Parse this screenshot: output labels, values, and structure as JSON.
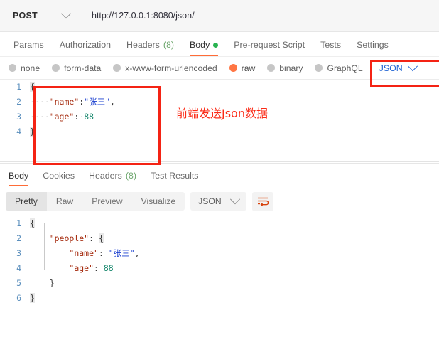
{
  "request_bar": {
    "method": "POST",
    "method_icon": "chevron-down-icon",
    "url": "http://127.0.0.1:8080/json/"
  },
  "request_tabs": [
    {
      "label": "Params",
      "active": false
    },
    {
      "label": "Authorization",
      "active": false
    },
    {
      "label": "Headers",
      "count": "(8)",
      "active": false
    },
    {
      "label": "Body",
      "active": true,
      "dot": "green-status-dot"
    },
    {
      "label": "Pre-request Script",
      "active": false
    },
    {
      "label": "Tests",
      "active": false
    },
    {
      "label": "Settings",
      "active": false
    }
  ],
  "body_types": [
    {
      "label": "none",
      "selected": false
    },
    {
      "label": "form-data",
      "selected": false
    },
    {
      "label": "x-www-form-urlencoded",
      "selected": false
    },
    {
      "label": "raw",
      "selected": true
    },
    {
      "label": "binary",
      "selected": false
    },
    {
      "label": "GraphQL",
      "selected": false
    }
  ],
  "body_format": {
    "label": "JSON",
    "icon": "chevron-down-icon"
  },
  "request_body": {
    "lines": [
      {
        "n": "1",
        "parts": [
          {
            "t": "{",
            "c": "p-brace"
          }
        ]
      },
      {
        "n": "2",
        "parts": [
          {
            "t": "····",
            "c": "p-ind"
          },
          {
            "t": "\"name\"",
            "c": "p-key"
          },
          {
            "t": ":",
            "c": "p-punct"
          },
          {
            "t": "\"张三\"",
            "c": "p-str"
          },
          {
            "t": ",",
            "c": "p-punct"
          }
        ]
      },
      {
        "n": "3",
        "parts": [
          {
            "t": "····",
            "c": "p-ind"
          },
          {
            "t": "\"age\"",
            "c": "p-key"
          },
          {
            "t": ":",
            "c": "p-punct"
          },
          {
            "t": "·",
            "c": "p-ind"
          },
          {
            "t": "88",
            "c": "p-num"
          }
        ]
      },
      {
        "n": "4",
        "parts": [
          {
            "t": "}",
            "c": "p-brace"
          }
        ]
      }
    ]
  },
  "annotations": {
    "note_text": "前端发送Json数据",
    "box_color": "#f42314"
  },
  "response_tabs": [
    {
      "label": "Body",
      "active": true
    },
    {
      "label": "Cookies",
      "active": false
    },
    {
      "label": "Headers",
      "count": "(8)",
      "active": false
    },
    {
      "label": "Test Results",
      "active": false
    }
  ],
  "response_toolbar": {
    "views": [
      {
        "label": "Pretty",
        "active": true
      },
      {
        "label": "Raw",
        "active": false
      },
      {
        "label": "Preview",
        "active": false
      },
      {
        "label": "Visualize",
        "active": false
      }
    ],
    "format": {
      "label": "JSON",
      "icon": "chevron-down-icon"
    },
    "wrap_button_icon": "wrap-text-icon"
  },
  "response_body": {
    "lines": [
      {
        "n": "1",
        "parts": [
          {
            "t": "{",
            "c": "p-brace"
          }
        ]
      },
      {
        "n": "2",
        "parts": [
          {
            "t": "    ",
            "c": "p-ind"
          },
          {
            "t": "\"people\"",
            "c": "p-key"
          },
          {
            "t": ": ",
            "c": "p-punct"
          },
          {
            "t": "{",
            "c": "p-brace"
          }
        ]
      },
      {
        "n": "3",
        "parts": [
          {
            "t": "        ",
            "c": "p-ind"
          },
          {
            "t": "\"name\"",
            "c": "p-key"
          },
          {
            "t": ": ",
            "c": "p-punct"
          },
          {
            "t": "\"张三\"",
            "c": "p-str"
          },
          {
            "t": ",",
            "c": "p-punct"
          }
        ]
      },
      {
        "n": "4",
        "parts": [
          {
            "t": "        ",
            "c": "p-ind"
          },
          {
            "t": "\"age\"",
            "c": "p-key"
          },
          {
            "t": ": ",
            "c": "p-punct"
          },
          {
            "t": "88",
            "c": "p-num"
          }
        ]
      },
      {
        "n": "5",
        "parts": [
          {
            "t": "    ",
            "c": "p-ind"
          },
          {
            "t": "}",
            "c": "p-punct"
          }
        ]
      },
      {
        "n": "6",
        "parts": [
          {
            "t": "}",
            "c": "p-brace"
          }
        ]
      }
    ]
  },
  "colors": {
    "accent_orange": "#ff6c37",
    "link_blue": "#2567d4",
    "status_green": "#29b351",
    "annotation_red": "#f42314"
  }
}
